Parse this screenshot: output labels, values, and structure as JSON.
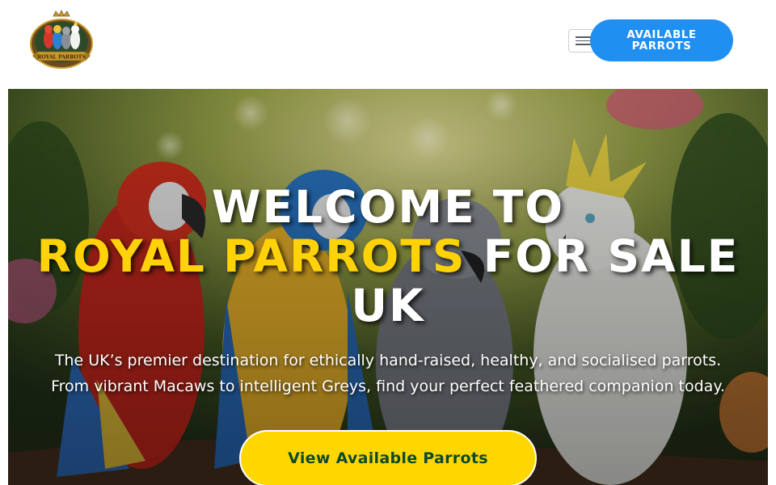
{
  "header": {
    "logo_text": "ROYAL PARROTS",
    "menu_icon": "hamburger-icon",
    "cta_label": "AVAILABLE PARROTS"
  },
  "hero": {
    "title_line1": "WELCOME TO",
    "title_accent": "ROYAL PARROTS",
    "title_line2_rest": "FOR SALE",
    "title_line3": "UK",
    "subtitle_line1": "The UK’s premier destination for ethically hand-raised, healthy, and socialised parrots.",
    "subtitle_line2": "From vibrant Macaws to intelligent Greys, find your perfect feathered companion today.",
    "cta_label": "View Available Parrots"
  },
  "colors": {
    "primary_blue": "#1f8ff2",
    "accent_yellow": "#ffd20a",
    "cta_text_green": "#0d4a2a"
  }
}
